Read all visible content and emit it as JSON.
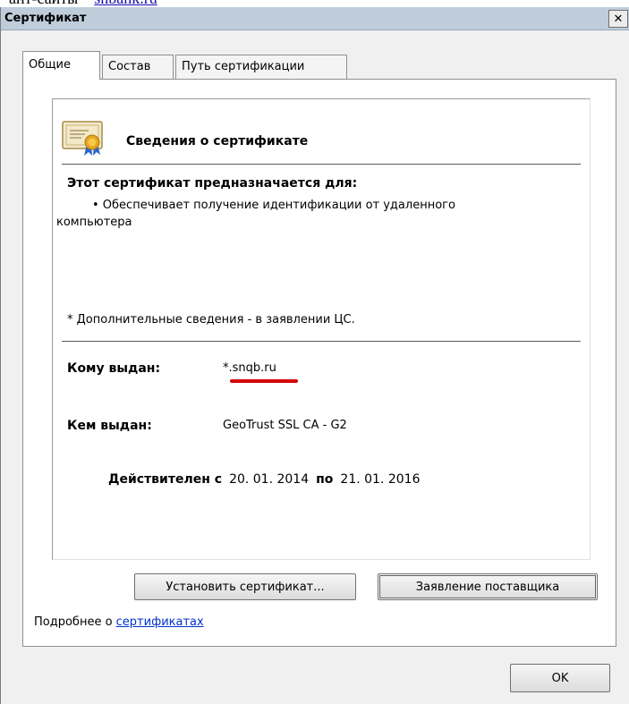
{
  "background_text": {
    "prefix": "ант-сайты – ",
    "link": "snbank.ru"
  },
  "window": {
    "title": "Сертификат",
    "close_glyph": "✕"
  },
  "tabs": [
    {
      "label": "Общие",
      "active": true
    },
    {
      "label": "Состав",
      "active": false
    },
    {
      "label": "Путь сертификации",
      "active": false
    }
  ],
  "cert": {
    "icon": "certificate-icon",
    "heading": "Сведения о сертификате",
    "purpose_title": "Этот сертификат предназначается для:",
    "purpose_line1": "• Обеспечивает получение идентификации от удаленного",
    "purpose_line2": "компьютера",
    "note": "* Дополнительные сведения - в заявлении ЦС.",
    "issued_to_label": "Кому выдан:",
    "issued_to_value": "*.snqb.ru",
    "issued_by_label": "Кем выдан:",
    "issued_by_value": "GeoTrust SSL CA - G2",
    "valid_from_label": "Действителен с",
    "valid_from": "20. 01. 2014",
    "valid_to_label": "по",
    "valid_to": "21. 01. 2016"
  },
  "buttons": {
    "install": "Установить сертификат...",
    "statement": "Заявление поставщика",
    "ok": "OK"
  },
  "more": {
    "prefix": "Подробнее о ",
    "link": "сертификатах"
  },
  "colors": {
    "titlebar": "#bfcddb",
    "accent_underline": "#d40000",
    "link": "#0033cc"
  }
}
